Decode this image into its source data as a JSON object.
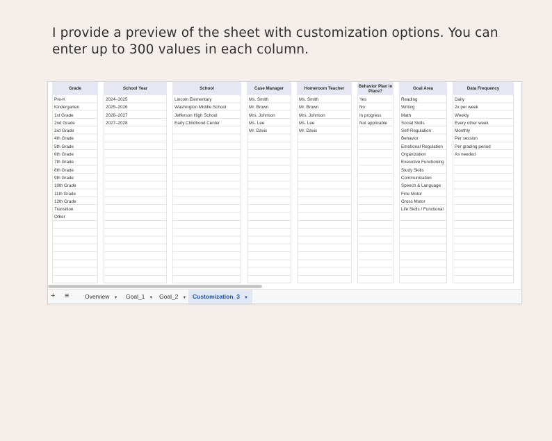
{
  "caption": "I provide a preview of the sheet with customization options. You can enter up to 300 values in each column.",
  "columns": [
    {
      "header": "Grade",
      "values": [
        "Pre-K",
        "Kindergarten",
        "1st Grade",
        "2nd Grade",
        "3rd Grade",
        "4th Grade",
        "5th Grade",
        "6th Grade",
        "7th Grade",
        "8th Grade",
        "9th Grade",
        "10th Grade",
        "11th Grade",
        "12th Grade",
        "Transition",
        "Other"
      ]
    },
    {
      "header": "School Year",
      "values": [
        "2024–2025",
        "2025–2026",
        "2026–2027",
        "2027–2028"
      ]
    },
    {
      "header": "School",
      "values": [
        "Lincoln Elementary",
        "Washington Middle School",
        "Jefferson High School",
        "Early Childhood Center"
      ]
    },
    {
      "header": "Case Manager",
      "values": [
        "Ms. Smith",
        "Mr. Brown",
        "Mrs. Johnson",
        "Ms. Lee",
        "Mr. Davis"
      ]
    },
    {
      "header": "Homeroom Teacher",
      "values": [
        "Ms. Smith",
        "Mr. Brown",
        "Mrs. Johnson",
        "Ms. Lee",
        "Mr. Davis"
      ]
    },
    {
      "header": "Behavior Plan in Place?",
      "values": [
        "Yes",
        "No",
        "In progress",
        "Not applicable"
      ]
    },
    {
      "header": "Goal Area",
      "values": [
        "Reading",
        "Writing",
        "Math",
        "Social Skills",
        "Self-Regulation",
        "Behavior",
        "Emotional Regulation",
        "Organization",
        "Executive Functioning",
        "Study Skills",
        "Communication",
        "Speech & Language",
        "Fine Motor",
        "Gross Motor",
        "Life Skills / Functional"
      ]
    },
    {
      "header": "Data Frequency",
      "values": [
        "Daily",
        "2x per week",
        "Weekly",
        "Every other week",
        "Monthly",
        "Per session",
        "Per grading period",
        "As needed"
      ]
    }
  ],
  "toolbar": {
    "add_icon": "plus-icon",
    "sheets_icon": "hamburger-menu-icon"
  },
  "tabs": [
    {
      "label": "Overview",
      "active": false
    },
    {
      "label": "Goal_1",
      "active": false
    },
    {
      "label": "Goal_2",
      "active": false
    },
    {
      "label": "Customization_3",
      "active": true
    }
  ],
  "colors": {
    "background": "#f5efeb",
    "header_fill": "#e6e7f2",
    "active_tab_fill": "#e1e8f5",
    "active_tab_text": "#1a52a8"
  }
}
